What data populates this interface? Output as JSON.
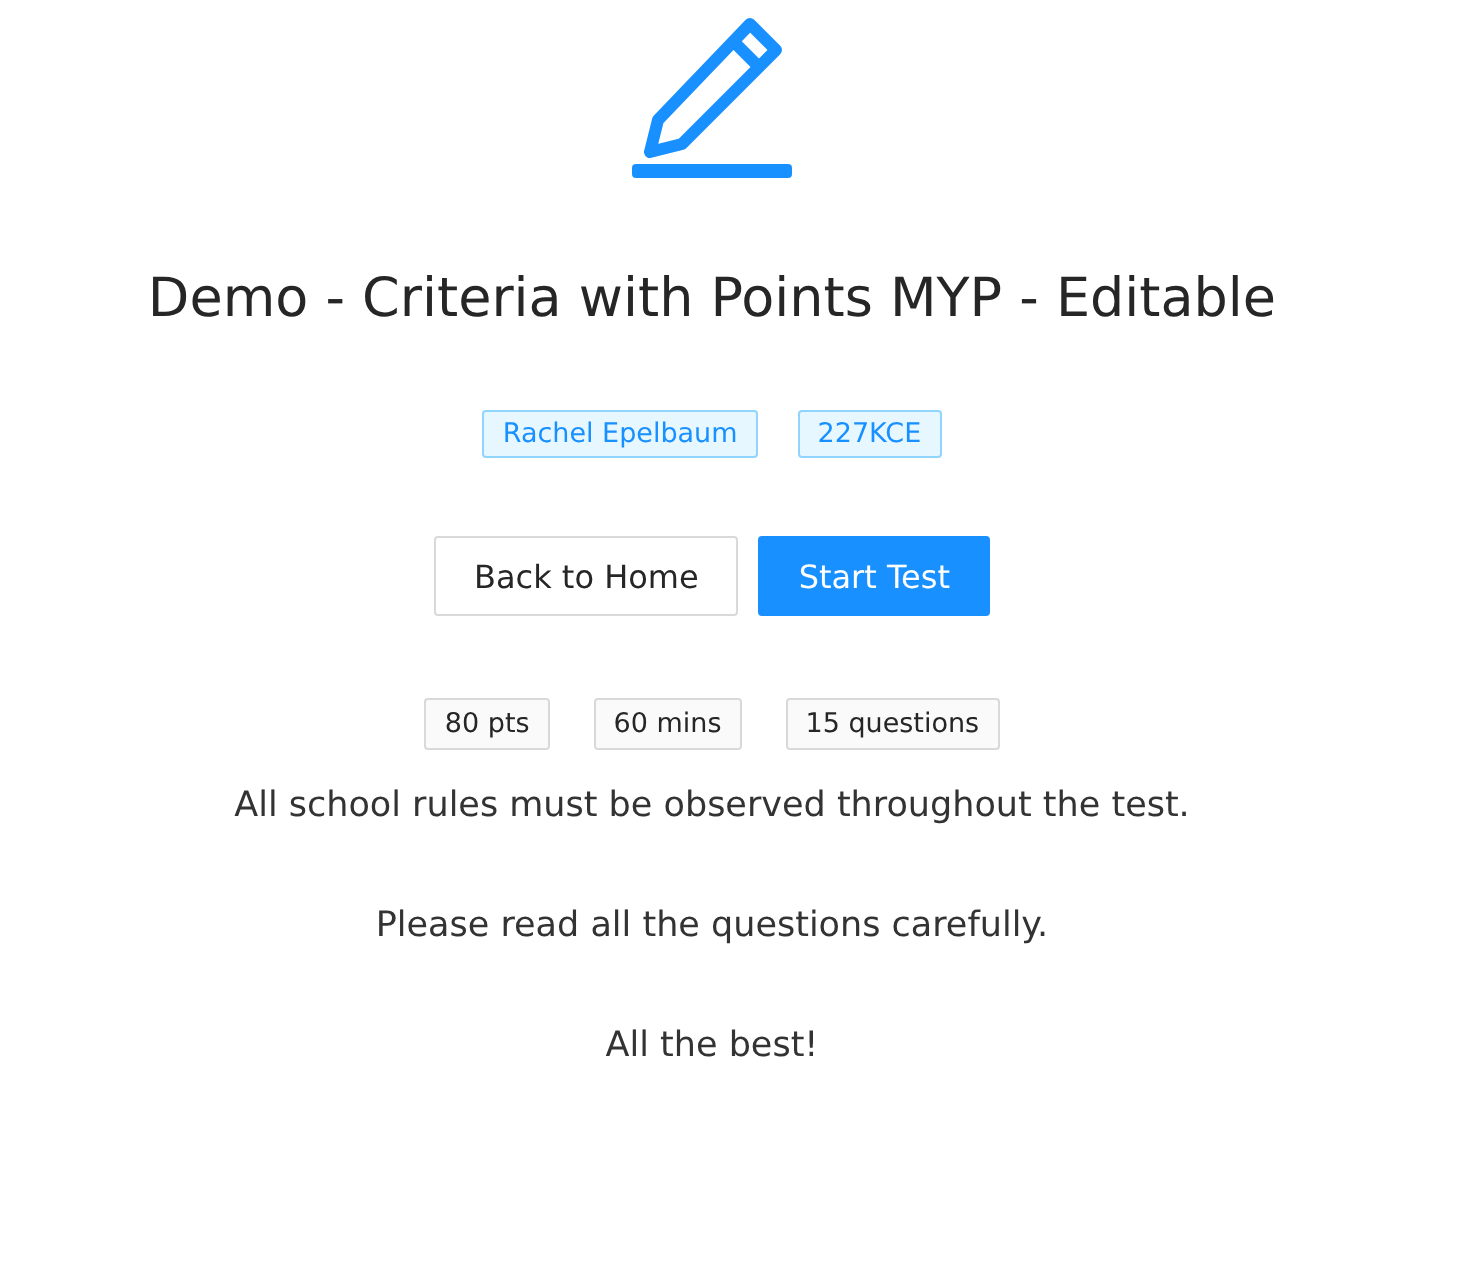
{
  "title": "Demo - Criteria with Points MYP - Editable",
  "tags": [
    "Rachel Epelbaum",
    "227KCE"
  ],
  "buttons": [
    {
      "label": "Back to Home",
      "kind": "default"
    },
    {
      "label": "Start Test",
      "kind": "primary"
    }
  ],
  "stats": [
    "80 pts",
    "60 mins",
    "15 questions"
  ],
  "instructions": [
    "All school rules must be observed throughout the test.",
    "Please read all the questions carefully.",
    "All the best!"
  ]
}
